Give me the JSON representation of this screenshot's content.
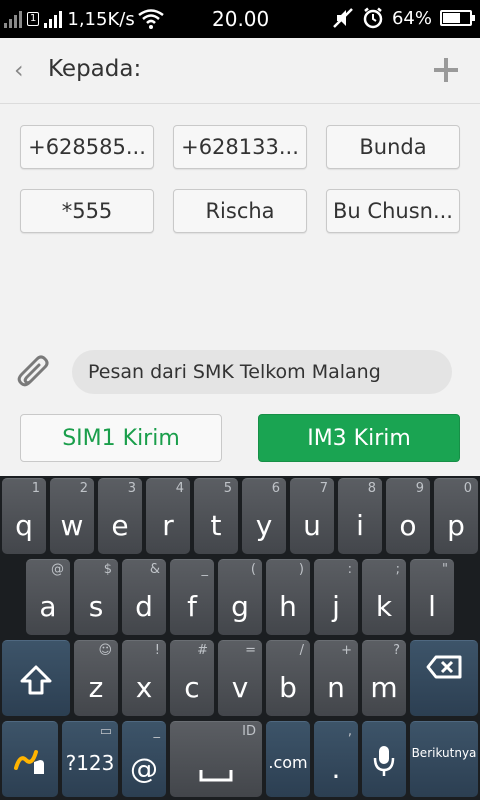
{
  "status_bar": {
    "speed": "1,15K/s",
    "time": "20.00",
    "battery": "64%",
    "battery_level": 0.64,
    "sim_index": "1"
  },
  "header": {
    "title": "Kepada:"
  },
  "recipients": [
    "+628585...",
    "+628133...",
    "Bunda",
    "*555",
    "Rischa",
    "Bu Chusn..."
  ],
  "compose": {
    "message": "Pesan dari SMK Telkom Malang"
  },
  "send": {
    "sim1": "SIM1 Kirim",
    "im3": "IM3 Kirim"
  },
  "keyboard": {
    "row1": [
      {
        "k": "q",
        "s": "1"
      },
      {
        "k": "w",
        "s": "2"
      },
      {
        "k": "e",
        "s": "3"
      },
      {
        "k": "r",
        "s": "4"
      },
      {
        "k": "t",
        "s": "5"
      },
      {
        "k": "y",
        "s": "6"
      },
      {
        "k": "u",
        "s": "7"
      },
      {
        "k": "i",
        "s": "8"
      },
      {
        "k": "o",
        "s": "9"
      },
      {
        "k": "p",
        "s": "0"
      }
    ],
    "row2": [
      {
        "k": "a",
        "s": "@"
      },
      {
        "k": "s",
        "s": "$"
      },
      {
        "k": "d",
        "s": "&"
      },
      {
        "k": "f",
        "s": "_"
      },
      {
        "k": "g",
        "s": "("
      },
      {
        "k": "h",
        "s": ")"
      },
      {
        "k": "j",
        "s": ":"
      },
      {
        "k": "k",
        "s": ";"
      },
      {
        "k": "l",
        "s": "\""
      }
    ],
    "row3": [
      {
        "k": "z",
        "s": "☺"
      },
      {
        "k": "x",
        "s": "!"
      },
      {
        "k": "c",
        "s": "#"
      },
      {
        "k": "v",
        "s": "="
      },
      {
        "k": "b",
        "s": "/"
      },
      {
        "k": "n",
        "s": "+"
      },
      {
        "k": "m",
        "s": "?"
      }
    ],
    "symbols": "?123",
    "at": "@",
    "at_sub": "_",
    "language": "ID",
    "dotcom": ".com",
    "period": ".",
    "period_sub": ",",
    "enter": "Berikutnya",
    "accent": "#ffb400"
  }
}
